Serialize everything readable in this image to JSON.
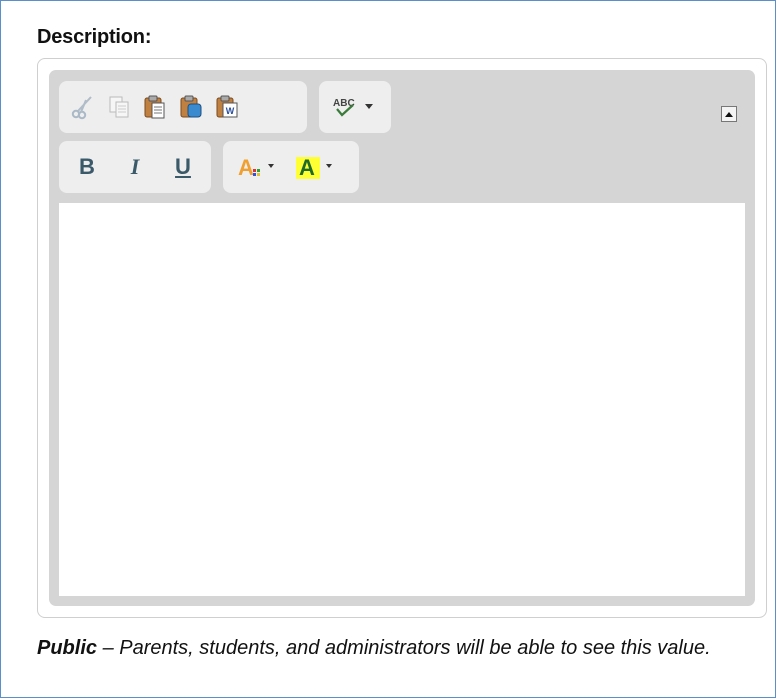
{
  "field": {
    "label": "Description:"
  },
  "toolbar": {
    "row1": [
      {
        "name": "cut-icon",
        "enabled": false
      },
      {
        "name": "copy-icon",
        "enabled": false
      },
      {
        "name": "paste-icon",
        "enabled": true
      },
      {
        "name": "paste-text-icon",
        "enabled": true
      },
      {
        "name": "paste-from-word-icon",
        "enabled": true
      }
    ],
    "spellcheck": {
      "name": "spellcheck-icon",
      "text": "ABC"
    },
    "row2": [
      {
        "name": "bold-button",
        "text": "B"
      },
      {
        "name": "italic-button",
        "text": "I"
      },
      {
        "name": "underline-button",
        "text": "U"
      }
    ],
    "text_color": {
      "name": "text-color-icon",
      "text": "A",
      "color": "#f0a030"
    },
    "background_color": {
      "name": "background-color-icon",
      "text": "A",
      "color": "#ffff33"
    },
    "collapse": {
      "name": "collapse-toolbar-icon"
    }
  },
  "editor": {
    "content": ""
  },
  "note": {
    "strong": "Public",
    "rest": " – Parents, students, and administrators will be able to see this value."
  },
  "colors": {
    "border": "#5b8fc9",
    "toolbar_bg": "#d5d5d5",
    "group_bg": "#eeeeee",
    "format_text": "#3a5a6a"
  }
}
